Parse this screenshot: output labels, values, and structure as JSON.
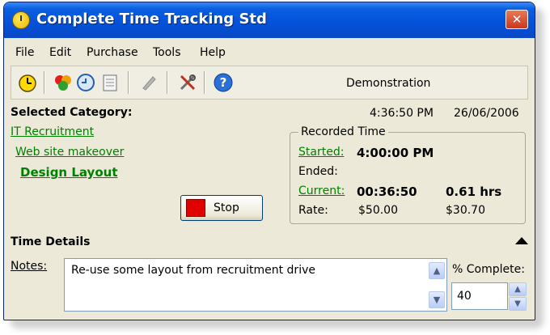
{
  "window": {
    "title": "Complete Time Tracking Std",
    "close_glyph": "✕"
  },
  "menu": [
    "File",
    "Edit",
    "Purchase",
    "Tools",
    "Help"
  ],
  "toolbar": {
    "icons": [
      "stopwatch-icon",
      "categories-icon",
      "timer-icon",
      "notepad-icon",
      "pencil-icon",
      "tools-icon",
      "help-icon"
    ],
    "status": "Demonstration"
  },
  "category": {
    "label": "Selected Category:",
    "time": "4:36:50 PM",
    "date": "26/06/2006",
    "path": [
      "IT Recruitment",
      "Web site makeover",
      "Design Layout"
    ]
  },
  "recorded": {
    "legend": "Recorded Time",
    "started_label": "Started:",
    "started_value": "4:00:00 PM",
    "ended_label": "Ended:",
    "current_label": "Current:",
    "current_value": "00:36:50",
    "current_hours": "0.61 hrs",
    "rate_label": "Rate:",
    "rate_value": "$50.00",
    "amount": "$30.70"
  },
  "stop_button": {
    "label": "Stop"
  },
  "details": {
    "heading": "Time Details",
    "notes_label": "Notes:",
    "notes_value": "Re-use some layout from recruitment drive",
    "pct_label": "% Complete:",
    "pct_value": "40"
  },
  "colors": {
    "title_bar": "#0351d9",
    "link_green": "#008000",
    "stop_red": "#e00000"
  }
}
